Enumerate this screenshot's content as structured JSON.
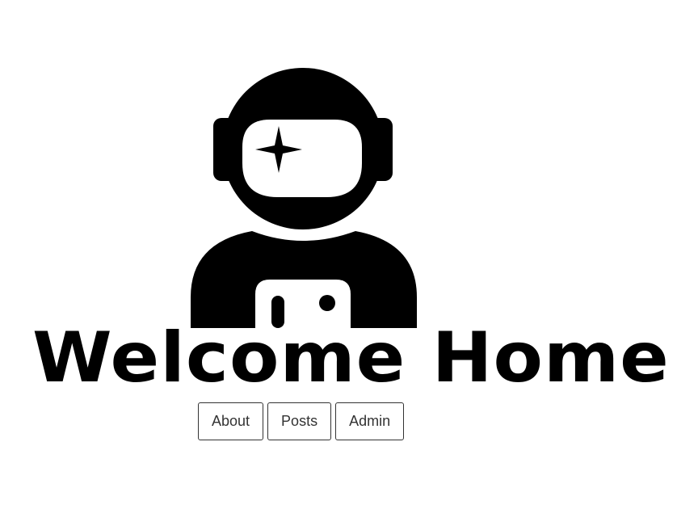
{
  "hero": {
    "icon": "astronaut-icon"
  },
  "page_title": "Welcome Home",
  "nav": {
    "about_label": "About",
    "posts_label": "Posts",
    "admin_label": "Admin"
  },
  "colors": {
    "background": "#ffffff",
    "text": "#000000",
    "button_border": "#333333"
  }
}
